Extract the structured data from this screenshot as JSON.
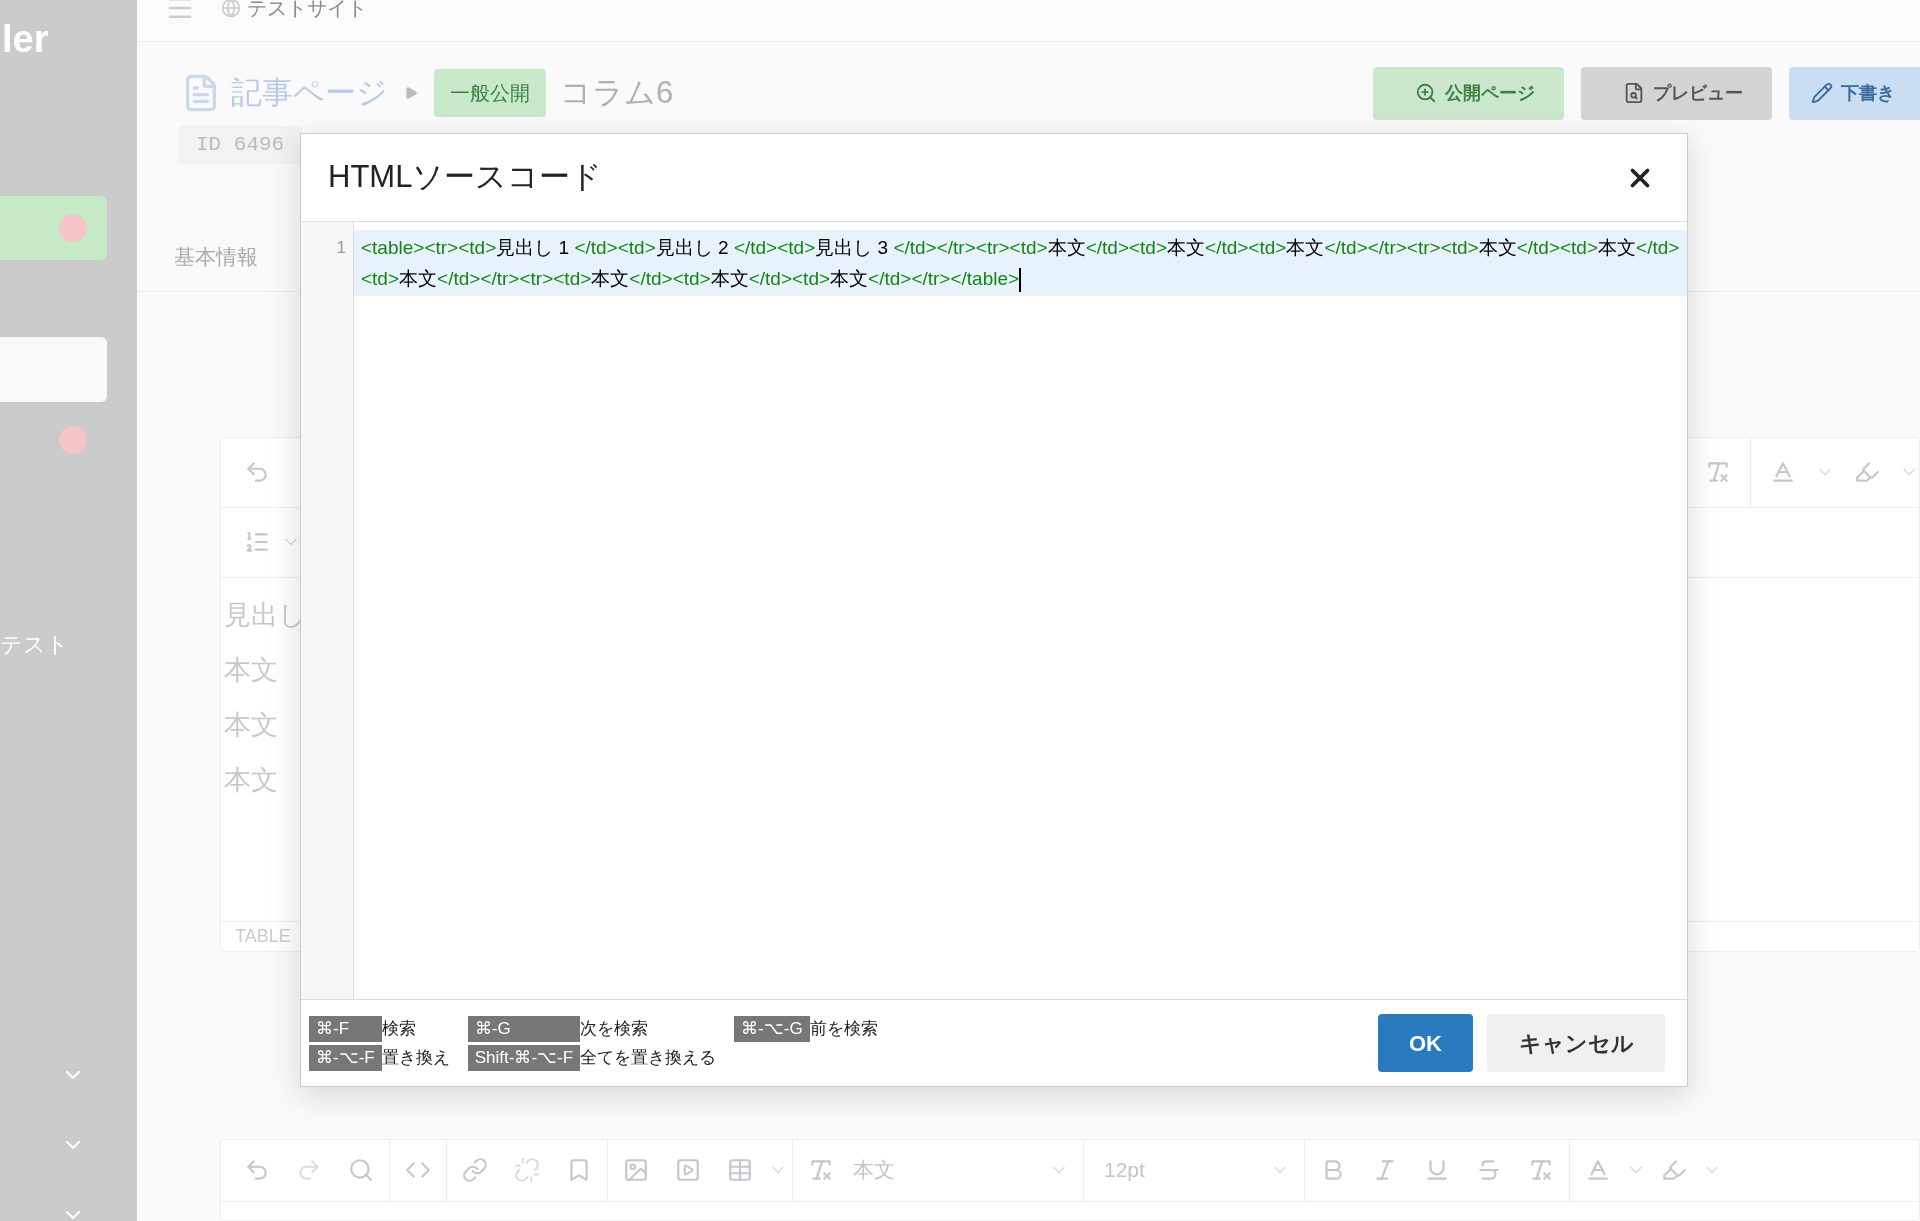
{
  "sidebar": {
    "logo": "ler",
    "items": [
      {
        "kind": "highlight",
        "alert": true
      },
      {
        "kind": "panel",
        "alert": false
      },
      {
        "kind": "plain",
        "alert": true
      },
      {
        "kind": "label",
        "label": "テスト",
        "alert": false
      }
    ]
  },
  "topbar": {
    "site": "テストサイト"
  },
  "header": {
    "breadcrumb": "記事ページ",
    "status_badge": "一般公開",
    "title": "コラム6",
    "id": "ID 6496",
    "buttons": [
      {
        "label": "公開ページ",
        "kind": "public"
      },
      {
        "label": "プレビュー",
        "kind": "preview"
      },
      {
        "label": "下書き",
        "kind": "draft"
      }
    ]
  },
  "section_tab": "基本情報",
  "editor": {
    "rows": [
      "見出し",
      "本文",
      "本文",
      "本文"
    ],
    "footer": "TABLE"
  },
  "bottom_toolbar": {
    "block_format": "本文",
    "font_size": "12pt"
  },
  "modal": {
    "title": "HTMLソースコード",
    "code_lines": [
      {
        "number": "1",
        "text": "<table><tr><td>見出し 1 </td><td>見出し 2 </td><td>見出し 3 </td></tr><tr><td>本文</td><td>本文</td><td>本文</td></tr><tr><td>本文</td><td>本文</td><td>本文</td></tr><tr><td>本文</td><td>本文</td><td>本文</td></tr></table>",
        "active": true
      }
    ],
    "shortcut_columns": [
      [
        {
          "keys": "⌘-F",
          "label": "検索"
        },
        {
          "keys": "⌘-⌥-F",
          "label": "置き換え"
        }
      ],
      [
        {
          "keys": "⌘-G",
          "label": "次を検索"
        },
        {
          "keys": "Shift-⌘-⌥-F",
          "label": "全てを置き換える"
        }
      ],
      [
        {
          "keys": "⌘-⌥-G",
          "label": "前を検索"
        }
      ]
    ],
    "buttons": [
      {
        "label": "OK",
        "kind": "primary"
      },
      {
        "label": "キャンセル",
        "kind": "secondary"
      }
    ]
  }
}
